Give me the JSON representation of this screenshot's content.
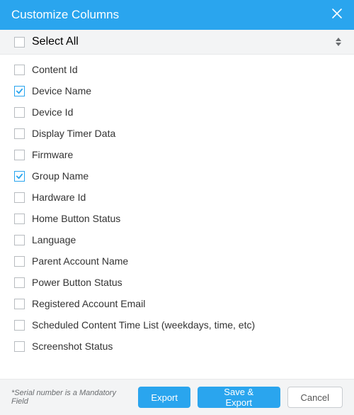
{
  "dialog": {
    "title": "Customize Columns",
    "select_all_label": "Select All",
    "footer_note": "*Serial number is a Mandatory Field",
    "export_label": "Export",
    "save_export_label": "Save & Export",
    "cancel_label": "Cancel"
  },
  "columns": [
    {
      "label": "Content Id",
      "checked": false
    },
    {
      "label": "Device Name",
      "checked": true
    },
    {
      "label": "Device Id",
      "checked": false
    },
    {
      "label": "Display Timer Data",
      "checked": false
    },
    {
      "label": "Firmware",
      "checked": false
    },
    {
      "label": "Group Name",
      "checked": true
    },
    {
      "label": "Hardware Id",
      "checked": false
    },
    {
      "label": "Home Button Status",
      "checked": false
    },
    {
      "label": "Language",
      "checked": false
    },
    {
      "label": "Parent Account Name",
      "checked": false
    },
    {
      "label": "Power Button Status",
      "checked": false
    },
    {
      "label": "Registered Account Email",
      "checked": false
    },
    {
      "label": "Scheduled Content Time List (weekdays, time, etc)",
      "checked": false
    },
    {
      "label": "Screenshot Status",
      "checked": false
    }
  ]
}
